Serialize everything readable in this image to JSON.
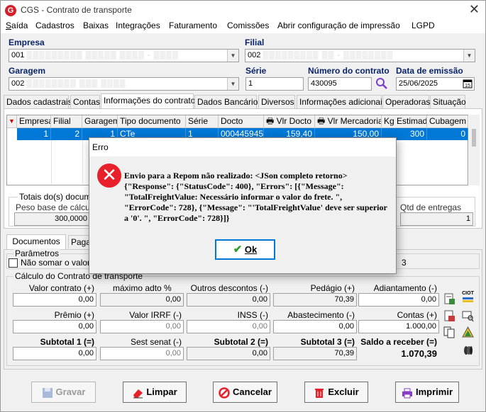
{
  "window": {
    "title": "CGS - Contrato de transporte",
    "app_logo": "G"
  },
  "menu": [
    "Saída",
    "Cadastros",
    "Baixas",
    "Integrações",
    "Faturamento",
    "Comissões",
    "Abrir configuração de impressão",
    "LGPD"
  ],
  "menu_accel": [
    "S",
    "C",
    "B",
    "I",
    "F",
    "m",
    "A",
    "L"
  ],
  "header": {
    "empresa_label": "Empresa",
    "empresa_value": "001",
    "empresa_blur": "▒▒▒▒▒▒▒▒▒ ▒▒▒▒▒ ▒▒▒▒ - ▒▒▒▒",
    "filial_label": "Filial",
    "filial_value": "002",
    "filial_blur": "▒▒▒▒▒▒▒▒▒ ▒▒ - ▒▒▒▒▒▒▒▒",
    "garagem_label": "Garagem",
    "garagem_value": "002",
    "garagem_blur": "▒▒▒▒▒▒▒▒ ▒▒▒ ▒▒▒▒",
    "serie_label": "Série",
    "serie_value": "1",
    "numero_label": "Número do contrato",
    "numero_value": "430095",
    "data_label": "Data de emissão",
    "data_value": "25/06/2025"
  },
  "tabs": [
    "Dados cadastrais",
    "Contas",
    "Informações do contrato",
    "Dados Bancários",
    "Diversos",
    "Informações adicionais",
    "Operadoras",
    "Situação"
  ],
  "active_tab": "Informações do contrato",
  "grid": {
    "columns": [
      "Empresa",
      "Filial",
      "Garagem",
      "Tipo documento",
      "Série",
      "Docto",
      "Vlr Docto",
      "Vlr Mercadoria",
      "Kg Estimado",
      "Cubagem"
    ],
    "row": [
      "1",
      "2",
      "1",
      "CTe",
      "1",
      "000445945",
      "159,40",
      "150,00",
      "300",
      "0"
    ]
  },
  "totais": {
    "label": "Totais do(s) documen",
    "peso_label": "Peso base de cálculo",
    "peso_value": "300,0000",
    "qtd_label": "Qtd de entregas",
    "qtd_value": "1"
  },
  "bottom_tabs": [
    "Documentos",
    "Paga"
  ],
  "parametros": {
    "label": "Parâmetros",
    "checkbox_label": "Não somar o valor do",
    "right_value": "3"
  },
  "calculo": {
    "label": "Cálculo do Contrato de transporte",
    "valor_contrato_label": "Valor contrato (+)",
    "valor_contrato": "0,00",
    "maximo_adto_label": "máximo adto %",
    "maximo_adto": "0,00",
    "outros_desc_label": "Outros descontos (-)",
    "outros_desc": "0,00",
    "pedagio_label": "Pedágio (+)",
    "pedagio": "70,39",
    "adiantamento_label": "Adiantamento (-)",
    "adiantamento": "0,00",
    "premio_label": "Prêmio (+)",
    "premio": "0,00",
    "irrf_label": "Valor IRRF (-)",
    "irrf": "0,00",
    "inss_label": "INSS (-)",
    "inss": "0,00",
    "abastecimento_label": "Abastecimento (-)",
    "abastecimento": "0,00",
    "contas_label": "Contas (+)",
    "contas": "1.000,00",
    "subtotal1_label": "Subtotal 1 (=)",
    "subtotal1": "0,00",
    "sest_label": "Sest senat (-)",
    "sest": "0,00",
    "subtotal2_label": "Subtotal 2 (=)",
    "subtotal2": "0,00",
    "subtotal3_label": "Subtotal 3 (=)",
    "subtotal3": "70,39",
    "saldo_label": "Saldo a receber (=)",
    "saldo": "1.070,39"
  },
  "side_icons": {
    "ciot_label": "CIOT"
  },
  "buttons": {
    "gravar": "Gravar",
    "limpar": "Limpar",
    "cancelar": "Cancelar",
    "excluir": "Excluir",
    "imprimir": "Imprimir"
  },
  "dialog": {
    "title": "Erro",
    "message": "Envio para a Repom não realizado: <JSon completo retorno> {\"Response\": {\"StatusCode\": 400}, \"Errors\": [{\"Message\": \"TotalFreightValue: Necessário informar o valor do frete. \", \"ErrorCode\": 728}, {\"Message\": \"'TotalFreightValue' deve ser superior a '0'. \", \"ErrorCode\": 728}]}",
    "ok_label": "Ok"
  },
  "colors": {
    "accent": "#0078d7",
    "label_blue": "#0a246a",
    "error_red": "#e8202a"
  }
}
